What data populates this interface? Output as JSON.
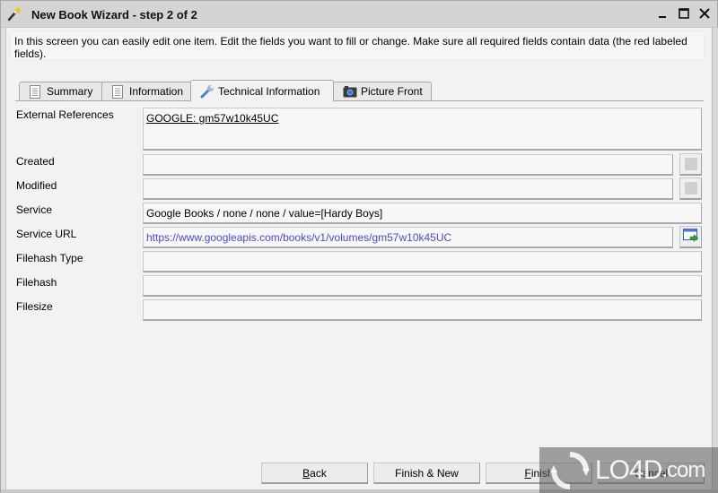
{
  "window": {
    "title": "New Book Wizard - step 2 of 2",
    "controls": {
      "minimize": "minimize",
      "maximize": "maximize",
      "close": "close"
    }
  },
  "instructions": "In this screen you can easily edit one item. Edit the fields you want to fill or change. Make sure all required fields contain data (the red labeled fields).",
  "tabs": [
    {
      "label": "Summary",
      "icon": "document-icon",
      "active": false
    },
    {
      "label": "Information",
      "icon": "document-icon",
      "active": false
    },
    {
      "label": "Technical Information",
      "icon": "wrench-icon",
      "active": true
    },
    {
      "label": "Picture Front",
      "icon": "camera-icon",
      "active": false
    }
  ],
  "form": {
    "external_references": {
      "label": "External References",
      "value": "GOOGLE: gm57w10k45UC"
    },
    "created": {
      "label": "Created",
      "value": ""
    },
    "modified": {
      "label": "Modified",
      "value": ""
    },
    "service": {
      "label": "Service",
      "value": "Google Books / none / none / value=[Hardy Boys]"
    },
    "service_url": {
      "label": "Service URL",
      "value": "https://www.googleapis.com/books/v1/volumes/gm57w10k45UC"
    },
    "filehash_type": {
      "label": "Filehash Type",
      "value": ""
    },
    "filehash": {
      "label": "Filehash",
      "value": ""
    },
    "filesize": {
      "label": "Filesize",
      "value": ""
    }
  },
  "buttons": {
    "back": {
      "accel": "B",
      "rest": "ack"
    },
    "finish_new": {
      "label": "Finish & New"
    },
    "finish": {
      "accel": "F",
      "rest": "inish"
    },
    "cancel": {
      "label": "Cancel"
    }
  },
  "watermark": {
    "brand": "LO4D",
    "suffix": ".com"
  },
  "colors": {
    "link": "#4a4ad8",
    "titlebar": "#d4d4d4",
    "background": "#f2f2f2"
  }
}
